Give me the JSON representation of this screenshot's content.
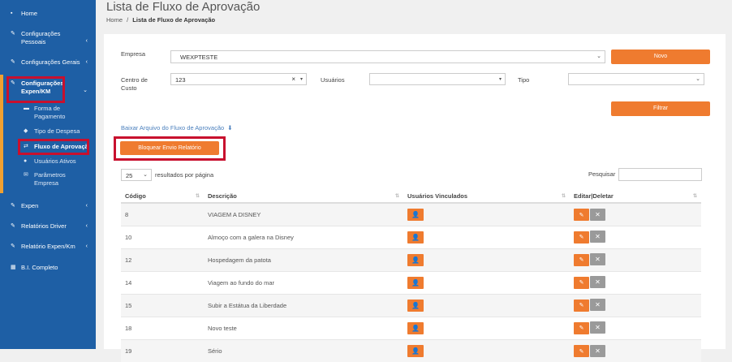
{
  "sidebar": {
    "items": [
      {
        "icon": "home-icon",
        "glyph": "▪",
        "label": "Home",
        "chevron": ""
      },
      {
        "icon": "edit-icon",
        "glyph": "✎",
        "label": "Configurações Pessoais",
        "chevron": "‹"
      },
      {
        "icon": "edit-icon",
        "glyph": "✎",
        "label": "Configurações Gerais",
        "chevron": "‹"
      },
      {
        "icon": "edit-icon",
        "glyph": "✎",
        "label": "Configurações Expen/KM",
        "chevron": "⌄"
      },
      {
        "icon": "edit-icon",
        "glyph": "✎",
        "label": "Expen",
        "chevron": "‹"
      },
      {
        "icon": "edit-icon",
        "glyph": "✎",
        "label": "Relatórios Driver",
        "chevron": "‹"
      },
      {
        "icon": "edit-icon",
        "glyph": "✎",
        "label": "Relatório Expen/Km",
        "chevron": "‹"
      },
      {
        "icon": "chart-icon",
        "glyph": "▦",
        "label": "B.I. Completo",
        "chevron": ""
      }
    ],
    "subitems": [
      {
        "glyph": "▬",
        "label": "Forma de Pagamento"
      },
      {
        "glyph": "◆",
        "label": "Tipo de Despesa"
      },
      {
        "glyph": "⇄",
        "label": "Fluxo de Aprovação"
      },
      {
        "glyph": "●",
        "label": "Usuários Ativos"
      },
      {
        "glyph": "✉",
        "label": "Parâmetros Empresa"
      }
    ]
  },
  "header": {
    "title": "Lista de Fluxo de Aprovação",
    "breadcrumb_home": "Home",
    "breadcrumb_sep": "/",
    "breadcrumb_current": "Lista de Fluxo de Aprovação"
  },
  "form": {
    "empresa_label": "Empresa",
    "empresa_value": "WEXPTESTE",
    "novo_button": "Novo",
    "centro_label": "Centro de Custo",
    "centro_value": "123",
    "centro_clear": "×",
    "usuarios_label": "Usuários",
    "usuarios_value": "",
    "tipo_label": "Tipo",
    "tipo_value": "",
    "filtrar_button": "Filtrar",
    "download_link": "Baixar Arquivo do Fluxo de Aprovação",
    "block_button": "Bloquear Envio Relatório",
    "page_size": "25",
    "page_size_suffix": "resultados por página",
    "search_label": "Pesquisar",
    "search_value": ""
  },
  "table": {
    "columns": [
      "Código",
      "Descrição",
      "Usuários Vinculados",
      "Editar|Deletar"
    ],
    "rows": [
      {
        "codigo": "8",
        "descricao": "VIAGEM A DISNEY"
      },
      {
        "codigo": "10",
        "descricao": "Almoço com a galera na Disney"
      },
      {
        "codigo": "12",
        "descricao": "Hospedagem da patota"
      },
      {
        "codigo": "14",
        "descricao": "Viagem ao fundo do mar"
      },
      {
        "codigo": "15",
        "descricao": "Subir a Estátua da Liberdade"
      },
      {
        "codigo": "18",
        "descricao": "Novo teste"
      },
      {
        "codigo": "19",
        "descricao": "Sério"
      }
    ]
  },
  "icons": {
    "user": "user-icon",
    "edit": "edit-icon",
    "delete": "delete-icon",
    "download": "download-icon",
    "sort": "sort-icon"
  },
  "colors": {
    "sidebar": "#1e5fa5",
    "accent": "#ef7b2f",
    "highlight": "#c8102e"
  }
}
